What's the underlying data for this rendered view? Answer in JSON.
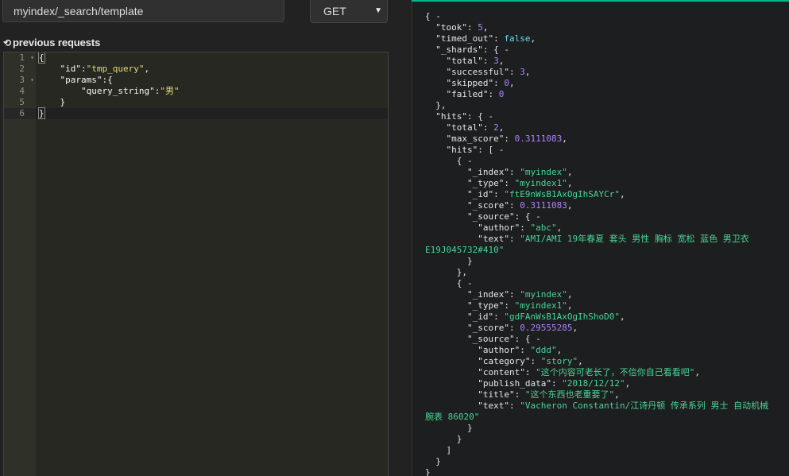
{
  "request": {
    "url_value": "myindex/_search/template",
    "method": "GET",
    "previous_requests_label": "previous requests",
    "history_icon": "history-icon",
    "editor_lines": [
      {
        "n": "1",
        "fold": true,
        "tokens": [
          {
            "t": "{",
            "c": "g"
          }
        ]
      },
      {
        "n": "2",
        "fold": false,
        "tokens": [
          {
            "t": "    \"id\":",
            "c": "k"
          },
          {
            "t": "\"tmp_query\"",
            "c": "s"
          },
          {
            "t": ",",
            "c": "k"
          }
        ]
      },
      {
        "n": "3",
        "fold": true,
        "tokens": [
          {
            "t": "    \"params\":{",
            "c": "k"
          }
        ]
      },
      {
        "n": "4",
        "fold": false,
        "tokens": [
          {
            "t": "        \"query_string\":",
            "c": "k"
          },
          {
            "t": "\"男\"",
            "c": "s"
          }
        ]
      },
      {
        "n": "5",
        "fold": false,
        "tokens": [
          {
            "t": "    }",
            "c": "k"
          }
        ]
      },
      {
        "n": "6",
        "fold": false,
        "tokens": [
          {
            "t": "}",
            "c": "g"
          }
        ]
      }
    ]
  },
  "response": {
    "lines": [
      [
        {
          "t": "{ -",
          "c": "pun"
        }
      ],
      [
        {
          "t": "  \"took\": ",
          "c": "pun"
        },
        {
          "t": "5",
          "c": "num"
        },
        {
          "t": ",",
          "c": "pun"
        }
      ],
      [
        {
          "t": "  \"timed_out\": ",
          "c": "pun"
        },
        {
          "t": "false",
          "c": "bool"
        },
        {
          "t": ",",
          "c": "pun"
        }
      ],
      [
        {
          "t": "  \"_shards\": { -",
          "c": "pun"
        }
      ],
      [
        {
          "t": "    \"total\": ",
          "c": "pun"
        },
        {
          "t": "3",
          "c": "num"
        },
        {
          "t": ",",
          "c": "pun"
        }
      ],
      [
        {
          "t": "    \"successful\": ",
          "c": "pun"
        },
        {
          "t": "3",
          "c": "num"
        },
        {
          "t": ",",
          "c": "pun"
        }
      ],
      [
        {
          "t": "    \"skipped\": ",
          "c": "pun"
        },
        {
          "t": "0",
          "c": "num"
        },
        {
          "t": ",",
          "c": "pun"
        }
      ],
      [
        {
          "t": "    \"failed\": ",
          "c": "pun"
        },
        {
          "t": "0",
          "c": "num"
        }
      ],
      [
        {
          "t": "  },",
          "c": "pun"
        }
      ],
      [
        {
          "t": "  \"hits\": { -",
          "c": "pun"
        }
      ],
      [
        {
          "t": "    \"total\": ",
          "c": "pun"
        },
        {
          "t": "2",
          "c": "num"
        },
        {
          "t": ",",
          "c": "pun"
        }
      ],
      [
        {
          "t": "    \"max_score\": ",
          "c": "pun"
        },
        {
          "t": "0.3111083",
          "c": "num"
        },
        {
          "t": ",",
          "c": "pun"
        }
      ],
      [
        {
          "t": "    \"hits\": [ -",
          "c": "pun"
        }
      ],
      [
        {
          "t": "      { -",
          "c": "pun"
        }
      ],
      [
        {
          "t": "        \"_index\": ",
          "c": "pun"
        },
        {
          "t": "\"myindex\"",
          "c": "str"
        },
        {
          "t": ",",
          "c": "pun"
        }
      ],
      [
        {
          "t": "        \"_type\": ",
          "c": "pun"
        },
        {
          "t": "\"myindex1\"",
          "c": "str"
        },
        {
          "t": ",",
          "c": "pun"
        }
      ],
      [
        {
          "t": "        \"_id\": ",
          "c": "pun"
        },
        {
          "t": "\"ftE9nWsB1AxOgIhSAYCr\"",
          "c": "str"
        },
        {
          "t": ",",
          "c": "pun"
        }
      ],
      [
        {
          "t": "        \"_score\": ",
          "c": "pun"
        },
        {
          "t": "0.3111083",
          "c": "num"
        },
        {
          "t": ",",
          "c": "pun"
        }
      ],
      [
        {
          "t": "        \"_source\": { -",
          "c": "pun"
        }
      ],
      [
        {
          "t": "          \"author\": ",
          "c": "pun"
        },
        {
          "t": "\"abc\"",
          "c": "str"
        },
        {
          "t": ",",
          "c": "pun"
        }
      ],
      [
        {
          "t": "          \"text\": ",
          "c": "pun"
        },
        {
          "t": "\"AMI/AMI 19年春夏 套头 男性 胸标 宽松 蓝色 男卫衣",
          "c": "str"
        }
      ],
      [
        {
          "t": "E19J045732#410\"",
          "c": "str"
        }
      ],
      [
        {
          "t": "        }",
          "c": "pun"
        }
      ],
      [
        {
          "t": "      },",
          "c": "pun"
        }
      ],
      [
        {
          "t": "      { -",
          "c": "pun"
        }
      ],
      [
        {
          "t": "        \"_index\": ",
          "c": "pun"
        },
        {
          "t": "\"myindex\"",
          "c": "str"
        },
        {
          "t": ",",
          "c": "pun"
        }
      ],
      [
        {
          "t": "        \"_type\": ",
          "c": "pun"
        },
        {
          "t": "\"myindex1\"",
          "c": "str"
        },
        {
          "t": ",",
          "c": "pun"
        }
      ],
      [
        {
          "t": "        \"_id\": ",
          "c": "pun"
        },
        {
          "t": "\"gdFAnWsB1AxOgIhShoD0\"",
          "c": "str"
        },
        {
          "t": ",",
          "c": "pun"
        }
      ],
      [
        {
          "t": "        \"_score\": ",
          "c": "pun"
        },
        {
          "t": "0.29555285",
          "c": "num"
        },
        {
          "t": ",",
          "c": "pun"
        }
      ],
      [
        {
          "t": "        \"_source\": { -",
          "c": "pun"
        }
      ],
      [
        {
          "t": "          \"author\": ",
          "c": "pun"
        },
        {
          "t": "\"ddd\"",
          "c": "str"
        },
        {
          "t": ",",
          "c": "pun"
        }
      ],
      [
        {
          "t": "          \"category\": ",
          "c": "pun"
        },
        {
          "t": "\"story\"",
          "c": "str"
        },
        {
          "t": ",",
          "c": "pun"
        }
      ],
      [
        {
          "t": "          \"content\": ",
          "c": "pun"
        },
        {
          "t": "\"这个内容可老长了，不信你自己看看吧\"",
          "c": "str"
        },
        {
          "t": ",",
          "c": "pun"
        }
      ],
      [
        {
          "t": "          \"publish_data\": ",
          "c": "pun"
        },
        {
          "t": "\"2018/12/12\"",
          "c": "str"
        },
        {
          "t": ",",
          "c": "pun"
        }
      ],
      [
        {
          "t": "          \"title\": ",
          "c": "pun"
        },
        {
          "t": "\"这个东西也老重要了\"",
          "c": "str"
        },
        {
          "t": ",",
          "c": "pun"
        }
      ],
      [
        {
          "t": "          \"text\": ",
          "c": "pun"
        },
        {
          "t": "\"Vacheron Constantin/江诗丹顿 传承系列 男士 自动机械",
          "c": "str"
        }
      ],
      [
        {
          "t": "腕表 86020\"",
          "c": "str"
        }
      ],
      [
        {
          "t": "        }",
          "c": "pun"
        }
      ],
      [
        {
          "t": "      }",
          "c": "pun"
        }
      ],
      [
        {
          "t": "    ]",
          "c": "pun"
        }
      ],
      [
        {
          "t": "  }",
          "c": "pun"
        }
      ],
      [
        {
          "t": "}",
          "c": "pun"
        }
      ]
    ]
  }
}
